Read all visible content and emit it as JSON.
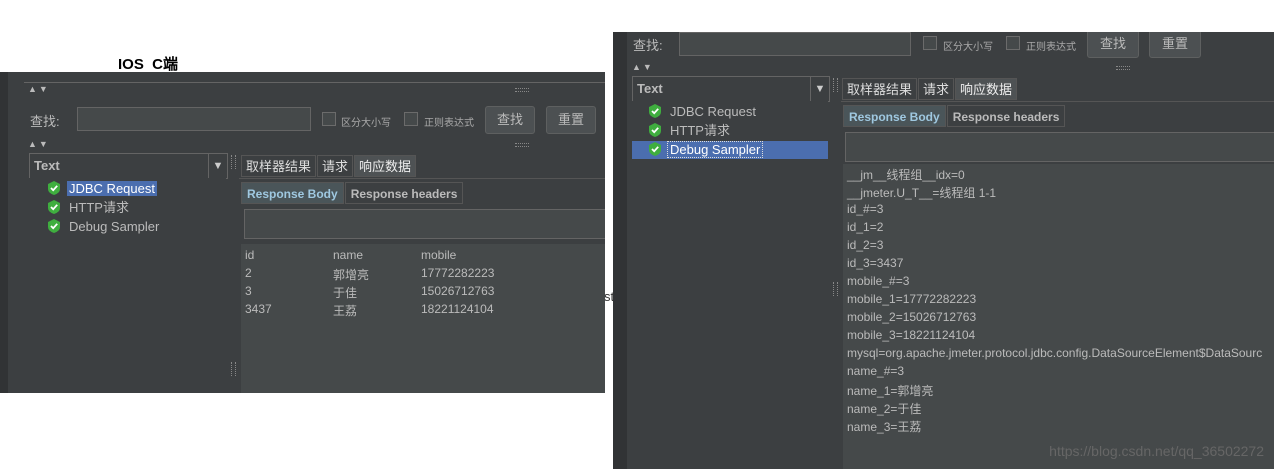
{
  "page": {
    "heading": "IOS  C端",
    "stray_text": "st",
    "watermark": "https://blog.csdn.net/qq_36502272"
  },
  "colors": {
    "panel": "#3c3f41",
    "field": "#45494a",
    "selection": "#4b6eaf",
    "text": "#bbbbbb"
  },
  "left": {
    "search_label": "查找:",
    "case_label": "区分大小写",
    "regex_label": "正则表达式",
    "find_button": "查找",
    "reset_button": "重置",
    "renderer": "Text",
    "tree": [
      {
        "label": "JDBC Request",
        "icon": "green-check-shield-icon",
        "selected": true
      },
      {
        "label": "HTTP请求",
        "icon": "green-check-shield-icon"
      },
      {
        "label": "Debug Sampler",
        "icon": "green-check-shield-icon"
      }
    ],
    "tabs": [
      "取样器结果",
      "请求",
      "响应数据"
    ],
    "subtabs": [
      "Response Body",
      "Response headers"
    ],
    "table": {
      "headers": [
        "id",
        "name",
        "mobile"
      ],
      "rows": [
        [
          "2",
          "郭增亮",
          "17772282223"
        ],
        [
          "3",
          "于佳",
          "15026712763"
        ],
        [
          "3437",
          "王荔",
          "18221124104"
        ]
      ]
    }
  },
  "right": {
    "search_label": "查找:",
    "case_label": "区分大小写",
    "regex_label": "正则表达式",
    "find_button": "查找",
    "reset_button": "重置",
    "renderer": "Text",
    "tree": [
      {
        "label": "JDBC Request",
        "icon": "green-check-shield-icon"
      },
      {
        "label": "HTTP请求",
        "icon": "green-check-shield-icon"
      },
      {
        "label": "Debug Sampler",
        "icon": "green-check-shield-icon",
        "selected": true
      }
    ],
    "tabs": [
      "取样器结果",
      "请求",
      "响应数据"
    ],
    "subtabs": [
      "Response Body",
      "Response headers"
    ],
    "lines": [
      "__jm__线程组__idx=0",
      "__jmeter.U_T__=线程组 1-1",
      "id_#=3",
      "id_1=2",
      "id_2=3",
      "id_3=3437",
      "mobile_#=3",
      "mobile_1=17772282223",
      "mobile_2=15026712763",
      "mobile_3=18221124104",
      "mysql=org.apache.jmeter.protocol.jdbc.config.DataSourceElement$DataSourc",
      "name_#=3",
      "name_1=郭增亮",
      "name_2=于佳",
      "name_3=王荔"
    ]
  }
}
